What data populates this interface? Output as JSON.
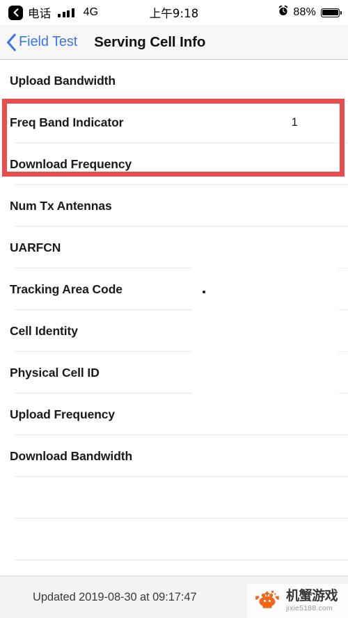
{
  "status_bar": {
    "back_chip_icon": "chevron-left-icon",
    "carrier": "电话",
    "signal_icon": "signal-bars-icon",
    "network": "4G",
    "time": "上午9:18",
    "alarm_icon": "alarm-clock-icon",
    "battery_percent": "88%",
    "battery_icon": "battery-full-icon"
  },
  "navbar": {
    "back_icon": "chevron-left-icon",
    "back_label": "Field Test",
    "title": "Serving Cell Info",
    "accent_color": "#3b76f0"
  },
  "list": {
    "rows": [
      {
        "label": "Upload Bandwidth",
        "value": ""
      },
      {
        "label": "Freq Band Indicator",
        "value": "1"
      },
      {
        "label": "Download Frequency",
        "value": ""
      },
      {
        "label": "Num Tx Antennas",
        "value": ""
      },
      {
        "label": "UARFCN",
        "value": ""
      },
      {
        "label": "Tracking Area Code",
        "value": ""
      },
      {
        "label": "Cell Identity",
        "value": ""
      },
      {
        "label": "Physical Cell ID",
        "value": ""
      },
      {
        "label": "Upload Frequency",
        "value": ""
      },
      {
        "label": "Download Bandwidth",
        "value": ""
      }
    ]
  },
  "annotation": {
    "name": "red-highlight-box",
    "color": "#ea4b4b"
  },
  "footer": {
    "updated_text": "Updated 2019-08-30 at 09:17:47"
  },
  "watermark": {
    "icon": "crab-logo-icon",
    "title": "机蟹游戏",
    "url": "jixie5188.com",
    "color": "#f2600f"
  }
}
